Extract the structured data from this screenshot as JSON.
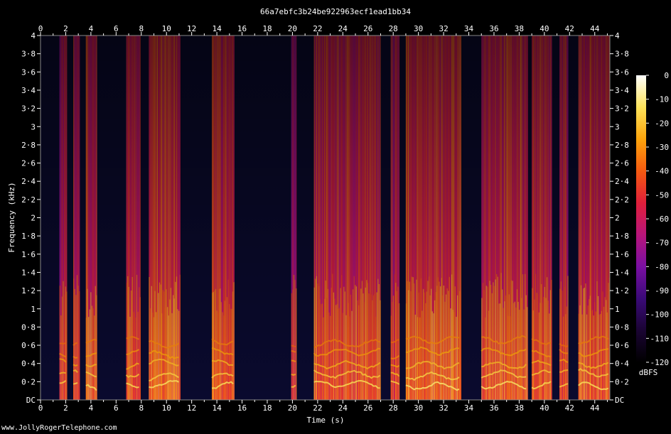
{
  "credit": "www.JollyRogerTelephone.com",
  "chart_data": {
    "type": "heatmap",
    "title": "66a7ebfc3b24be922963ecf1ead1bb34",
    "xlabel": "Time (s)",
    "ylabel": "Frequency (kHz)",
    "xlim": [
      0,
      45.2
    ],
    "ylim": [
      0,
      4
    ],
    "x_ticks": [
      {
        "value": 0,
        "label": "0"
      },
      {
        "value": 2,
        "label": "2"
      },
      {
        "value": 4,
        "label": "4"
      },
      {
        "value": 6,
        "label": "6"
      },
      {
        "value": 8,
        "label": "8"
      },
      {
        "value": 10,
        "label": "10"
      },
      {
        "value": 12,
        "label": "12"
      },
      {
        "value": 14,
        "label": "14"
      },
      {
        "value": 16,
        "label": "16"
      },
      {
        "value": 18,
        "label": "18"
      },
      {
        "value": 20,
        "label": "20"
      },
      {
        "value": 22,
        "label": "22"
      },
      {
        "value": 24,
        "label": "24"
      },
      {
        "value": 26,
        "label": "26"
      },
      {
        "value": 28,
        "label": "28"
      },
      {
        "value": 30,
        "label": "30"
      },
      {
        "value": 32,
        "label": "32"
      },
      {
        "value": 34,
        "label": "34"
      },
      {
        "value": 36,
        "label": "36"
      },
      {
        "value": 38,
        "label": "38"
      },
      {
        "value": 40,
        "label": "40"
      },
      {
        "value": 42,
        "label": "42"
      },
      {
        "value": 44,
        "label": "44"
      }
    ],
    "y_ticks": [
      {
        "value": 0,
        "label": "DC"
      },
      {
        "value": 0.2,
        "label": "0·2"
      },
      {
        "value": 0.4,
        "label": "0·4"
      },
      {
        "value": 0.6,
        "label": "0·6"
      },
      {
        "value": 0.8,
        "label": "0·8"
      },
      {
        "value": 1.0,
        "label": "1"
      },
      {
        "value": 1.2,
        "label": "1·2"
      },
      {
        "value": 1.4,
        "label": "1·4"
      },
      {
        "value": 1.6,
        "label": "1·6"
      },
      {
        "value": 1.8,
        "label": "1·8"
      },
      {
        "value": 2.0,
        "label": "2"
      },
      {
        "value": 2.2,
        "label": "2·2"
      },
      {
        "value": 2.4,
        "label": "2·4"
      },
      {
        "value": 2.6,
        "label": "2·6"
      },
      {
        "value": 2.8,
        "label": "2·8"
      },
      {
        "value": 3.0,
        "label": "3"
      },
      {
        "value": 3.2,
        "label": "3·2"
      },
      {
        "value": 3.4,
        "label": "3·4"
      },
      {
        "value": 3.6,
        "label": "3·6"
      },
      {
        "value": 3.8,
        "label": "3·8"
      },
      {
        "value": 4.0,
        "label": "4"
      }
    ],
    "colorbar": {
      "label": "dBFS",
      "range": [
        -120,
        0
      ],
      "ticks": [
        {
          "value": 0,
          "label": "0"
        },
        {
          "value": -10,
          "label": "-10"
        },
        {
          "value": -20,
          "label": "-20"
        },
        {
          "value": -30,
          "label": "-30"
        },
        {
          "value": -40,
          "label": "-40"
        },
        {
          "value": -50,
          "label": "-50"
        },
        {
          "value": -60,
          "label": "-60"
        },
        {
          "value": -70,
          "label": "-70"
        },
        {
          "value": -80,
          "label": "-80"
        },
        {
          "value": -90,
          "label": "-90"
        },
        {
          "value": -100,
          "label": "-100"
        },
        {
          "value": -110,
          "label": "-110"
        },
        {
          "value": -120,
          "label": "-120"
        }
      ],
      "colors": [
        "#000000",
        "#1a0433",
        "#3a0a78",
        "#7a0fa3",
        "#b8157a",
        "#e01f3a",
        "#f55a10",
        "#fca40c",
        "#fde35a",
        "#ffffff"
      ]
    },
    "background_color": "#0a0a2e",
    "segments": [
      {
        "start": 1.5,
        "end": 2.1,
        "level": 0.6
      },
      {
        "start": 2.6,
        "end": 3.1,
        "level": 0.7
      },
      {
        "start": 3.6,
        "end": 4.5,
        "level": 0.9
      },
      {
        "start": 6.8,
        "end": 7.9,
        "level": 0.8
      },
      {
        "start": 8.6,
        "end": 11.1,
        "level": 0.95
      },
      {
        "start": 13.6,
        "end": 15.4,
        "level": 0.9
      },
      {
        "start": 19.9,
        "end": 20.3,
        "level": 0.5
      },
      {
        "start": 21.7,
        "end": 27.0,
        "level": 0.85
      },
      {
        "start": 27.8,
        "end": 28.5,
        "level": 0.6
      },
      {
        "start": 29.0,
        "end": 33.4,
        "level": 1.0
      },
      {
        "start": 35.0,
        "end": 38.7,
        "level": 0.95
      },
      {
        "start": 39.0,
        "end": 40.6,
        "level": 0.8
      },
      {
        "start": 41.2,
        "end": 41.9,
        "level": 0.6
      },
      {
        "start": 42.7,
        "end": 45.2,
        "level": 0.9
      }
    ]
  }
}
